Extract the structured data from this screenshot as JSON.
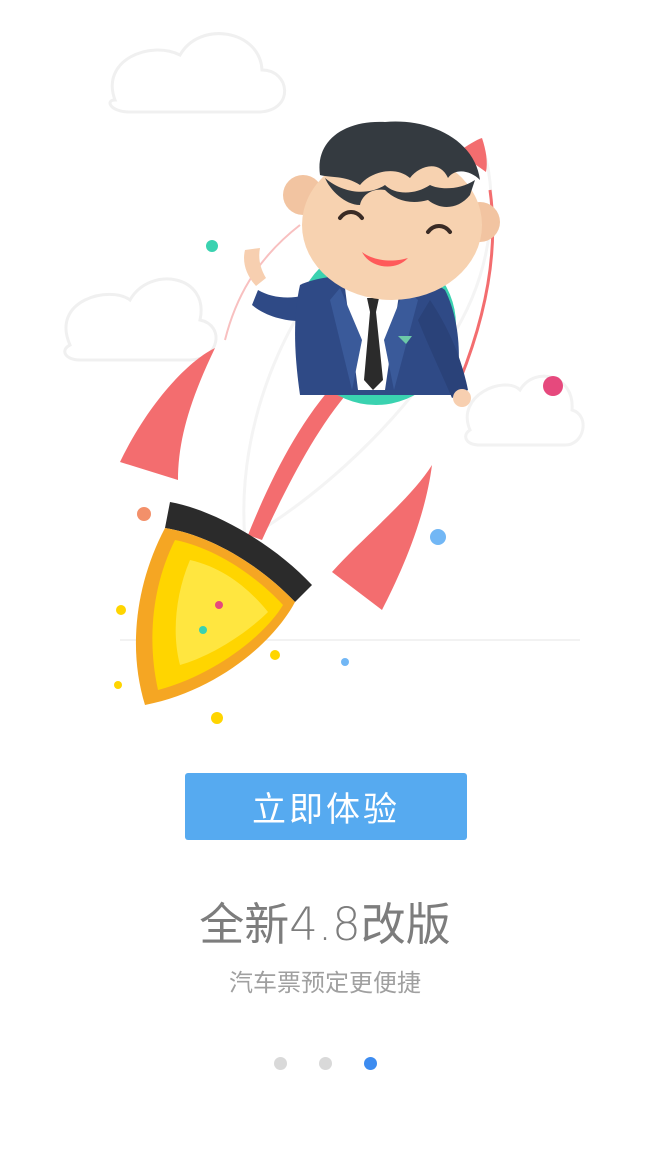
{
  "cta": {
    "label": "立即体验"
  },
  "headline": "全新4.8改版",
  "subline": "汽车票预定更便捷",
  "pager": {
    "count": 3,
    "active_index": 2
  },
  "colors": {
    "cta_bg": "#56aaf0",
    "headline": "#7d7d7d",
    "subline": "#a0a0a0",
    "dot": "#d9d9d9",
    "dot_active": "#3d8cf0",
    "rocket_fin": "#f36d6f",
    "rocket_flame": "#ffd500",
    "suit": "#2f4a86",
    "porthole": "#3ad2b0"
  },
  "icons": [
    "rocket-illustration-icon",
    "businessman-icon",
    "cloud-icon"
  ]
}
